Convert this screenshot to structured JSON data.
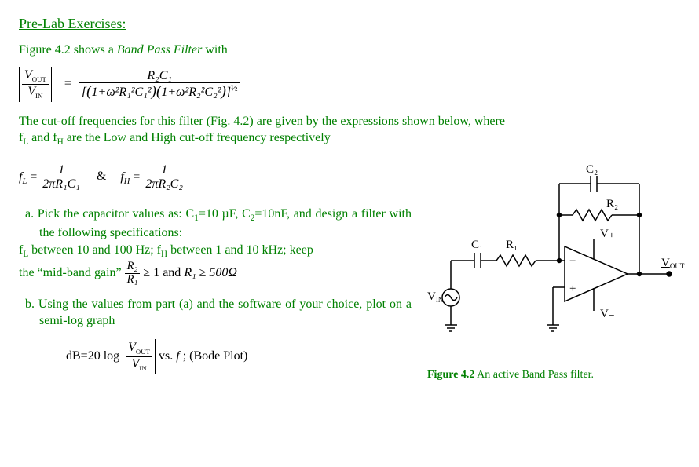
{
  "title": "Pre-Lab Exercises:",
  "intro_prefix": "Figure 4.2 shows a ",
  "intro_italic": "Band Pass Filter",
  "intro_suffix": " with",
  "eq_main_num": "R₂C₁",
  "eq_main_den_a": "1+ω²R₁²C₁²",
  "eq_main_den_b": "1+ω²R₂²C₂²",
  "eq_main_exp": "½",
  "eq_left_num": "V",
  "eq_left_num_sub": "OUT",
  "eq_left_den": "V",
  "eq_left_den_sub": "IN",
  "cutoff_text": "The cut-off frequencies for this filter (Fig. 4.2) are given by the expressions shown below, where f₋L and f₋H are the Low and High cut-off frequency respectively",
  "cutoff_line1": "The cut-off frequencies for this filter (Fig. 4.2) are given by the expressions shown below, where",
  "cutoff_line2_pre": "f",
  "cutoff_line2_subL": "L",
  "cutoff_line2_mid": " and f",
  "cutoff_line2_subH": "H",
  "cutoff_line2_post": " are the Low and High cut-off frequency respectively",
  "fL_label": "f",
  "fL_sub": "L",
  "fL_num": "1",
  "fL_den": "2πR₁C₁",
  "amp": "&",
  "fH_label": "f",
  "fH_sub": "H",
  "fH_num": "1",
  "fH_den": "2πR₂C₂",
  "task_a_prefix": "a. Pick the capacitor values as:  C",
  "task_a_c1sub": "1",
  "task_a_c1val": "=10 µF, C",
  "task_a_c2sub": "2",
  "task_a_c2val": "=10nF, and design a filter with the following specifications:",
  "task_a_line2_pre": "f",
  "task_a_line2_Lsub": "L",
  "task_a_line2_mid": " between 10 and 100 Hz; f",
  "task_a_line2_Hsub": "H",
  "task_a_line2_post": " between 1 and 10 kHz; keep",
  "task_a_line3_pre": "the “mid-band gain” ",
  "gain_num": "R₂",
  "gain_den": "R₁",
  "task_a_line3_mid": " ≥ 1  and  ",
  "task_a_line3_R1": "R₁ ≥ 500Ω",
  "task_b_text": "b. Using the values from part (a) and the software of your choice, plot on a semi-log graph",
  "bode_prefix": "dB=20 log",
  "bode_num": "V",
  "bode_num_sub": "OUT",
  "bode_den": "V",
  "bode_den_sub": "IN",
  "bode_suffix_pre": "  vs.  ",
  "bode_f": "f",
  "bode_suffix_post": " ;  (Bode Plot)",
  "caption_bold": "Figure 4.2",
  "caption_rest": "  An active Band Pass filter.",
  "circuit": {
    "C1": "C₁",
    "R1": "R₁",
    "C2": "C₂",
    "R2": "R₂",
    "Vplus": "V₊",
    "Vminus": "V₋",
    "Vin": "V",
    "VinSub": "IN",
    "Vout": "V",
    "VoutSub": "OUT"
  }
}
